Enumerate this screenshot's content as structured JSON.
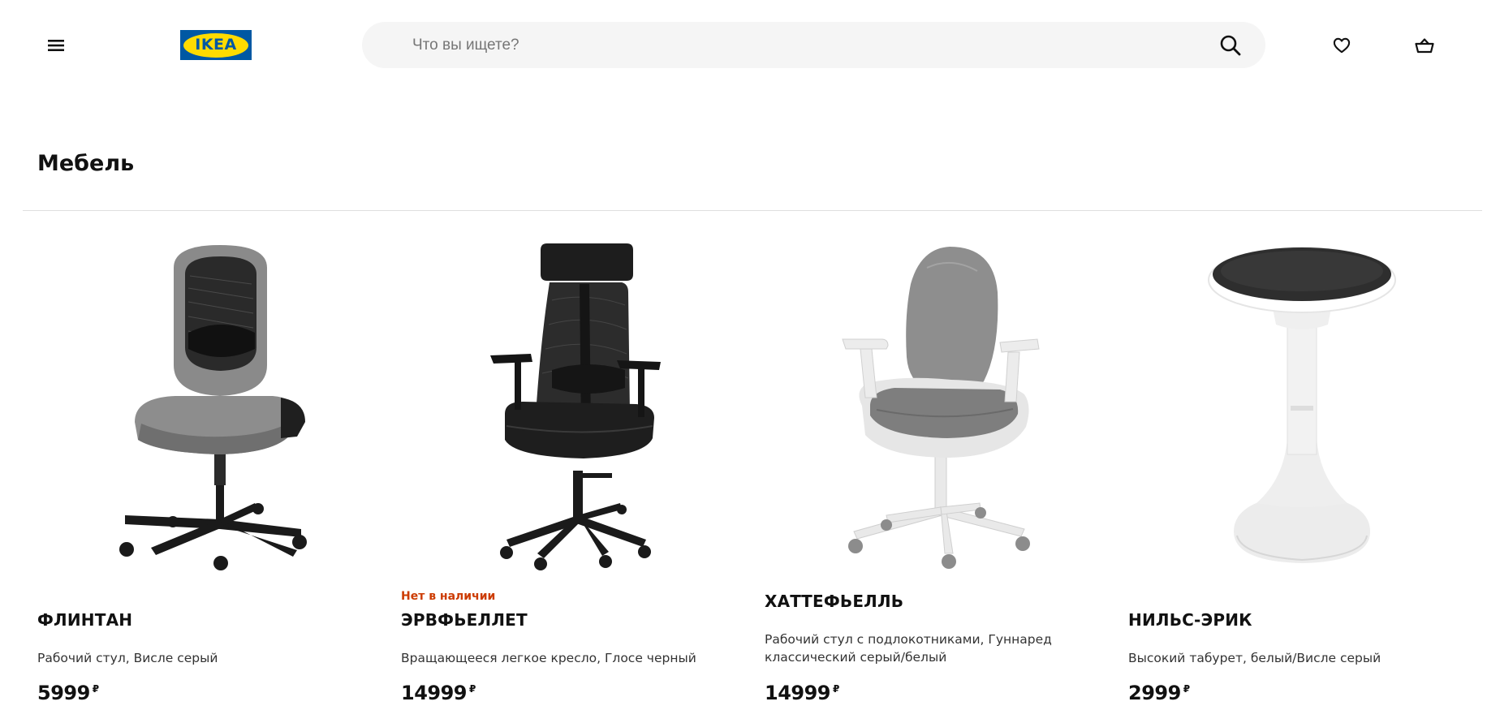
{
  "header": {
    "logo_text": "IKEA",
    "search_placeholder": "Что вы ищете?",
    "icons": {
      "menu": "hamburger-icon",
      "search": "search-icon",
      "favorites": "heart-icon",
      "cart": "basket-icon"
    }
  },
  "page": {
    "title": "Мебель"
  },
  "products": [
    {
      "badge": "",
      "name": "ФЛИНТАН",
      "description": "Рабочий стул, Висле серый",
      "price": "5999",
      "currency": "₽"
    },
    {
      "badge": "Нет в наличии",
      "name": "ЭРВФЬЕЛЛЕТ",
      "description": "Вращающееся легкое кресло, Глосе черный",
      "price": "14999",
      "currency": "₽"
    },
    {
      "badge": "",
      "name": "ХАТТЕФЬЕЛЛЬ",
      "description": "Рабочий стул с подлокотниками, Гуннаред классический серый/белый",
      "price": "14999",
      "currency": "₽"
    },
    {
      "badge": "",
      "name": "НИЛЬС-ЭРИК",
      "description": "Высокий табурет, белый/Висле серый",
      "price": "2999",
      "currency": "₽"
    }
  ],
  "colors": {
    "brand_blue": "#0058a3",
    "brand_yellow": "#ffdb00",
    "badge_orange": "#cc3b00",
    "search_bg": "#f5f5f5"
  }
}
